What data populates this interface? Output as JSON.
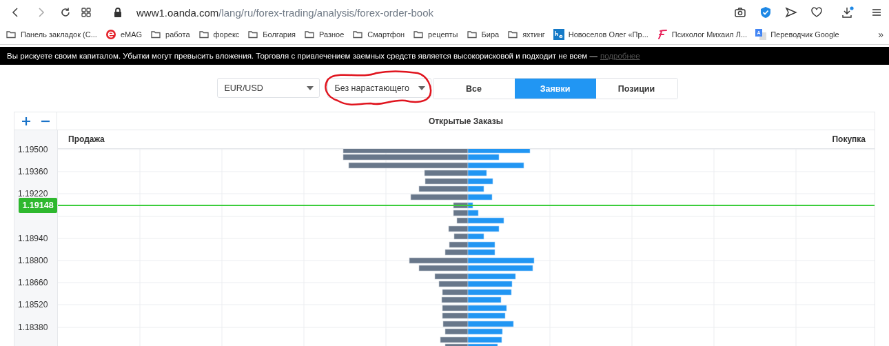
{
  "address_bar": {
    "domain": "www1.oanda.com",
    "path": "/lang/ru/forex-trading/analysis/forex-order-book"
  },
  "bookmarks": [
    {
      "label": "Панель закладок (С...",
      "kind": "folder"
    },
    {
      "label": "eMAG",
      "kind": "emag"
    },
    {
      "label": "работа",
      "kind": "folder"
    },
    {
      "label": "форекс",
      "kind": "folder"
    },
    {
      "label": "Болгария",
      "kind": "folder"
    },
    {
      "label": "Разное",
      "kind": "folder"
    },
    {
      "label": "Смартфон",
      "kind": "folder"
    },
    {
      "label": "рецепты",
      "kind": "folder"
    },
    {
      "label": "Бира",
      "kind": "folder"
    },
    {
      "label": "яхтинг",
      "kind": "folder"
    },
    {
      "label": "Новоселов Олег «Пр...",
      "kind": "he"
    },
    {
      "label": "Психолог Михаил Л...",
      "kind": "script-f"
    },
    {
      "label": "Переводчик Google",
      "kind": "translate"
    }
  ],
  "bookmarks_more": "»",
  "risk_banner": {
    "text": "Вы рискуете своим капиталом. Убытки могут превысить вложения. Торговля с привлечением заемных средств является высокорисковой и подходит не всем —",
    "link": "подробнее"
  },
  "controls": {
    "instrument": "EUR/USD",
    "mode": "Без нарастающего",
    "tabs": [
      {
        "label": "Все",
        "selected": false
      },
      {
        "label": "Заявки",
        "selected": true
      },
      {
        "label": "Позиции",
        "selected": false
      }
    ]
  },
  "order_book": {
    "title": "Открытые Заказы",
    "sell_label": "Продажа",
    "buy_label": "Покупка",
    "current_price": "1.19148",
    "price_ticks": [
      "1.19500",
      "1.19360",
      "1.19220",
      "1.18940",
      "1.18800",
      "1.18660",
      "1.18520",
      "1.18380"
    ]
  }
}
